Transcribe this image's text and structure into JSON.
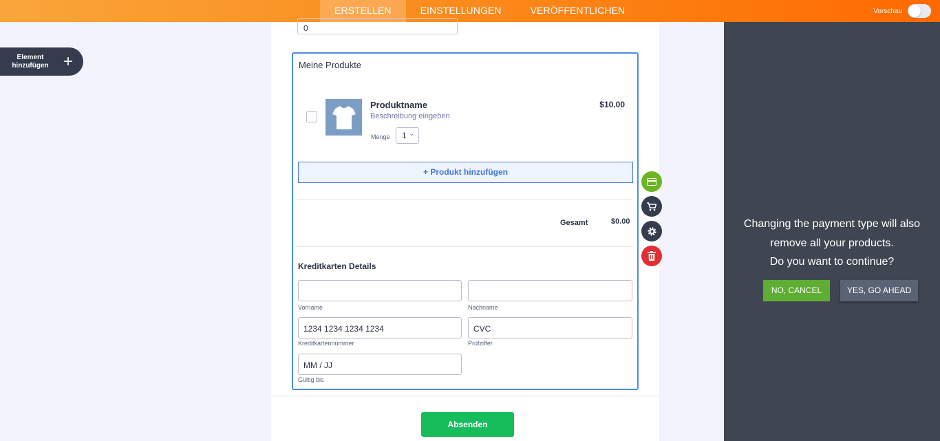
{
  "topbar": {
    "tabs": [
      {
        "label": "ERSTELLEN",
        "active": true
      },
      {
        "label": "EINSTELLUNGEN",
        "active": false
      },
      {
        "label": "VERÖFFENTLICHEN",
        "active": false
      }
    ],
    "preview_label": "Vorschau",
    "preview_enabled": false
  },
  "sidebar": {
    "add_element_label_line1": "Element",
    "add_element_label_line2": "hinzufügen",
    "add_icon": "plus-icon"
  },
  "form": {
    "top_input_value": "0",
    "products": {
      "title": "Meine Produkte",
      "items": [
        {
          "name": "Produktname",
          "description": "Beschreibung eingeben",
          "price": "$10.00",
          "quantity_label": "Menge",
          "quantity_value": "1",
          "image_icon": "tshirt-icon"
        }
      ],
      "add_product_label": "+ Produkt hinzufügen",
      "total_label": "Gesamt",
      "total_value": "$0.00"
    },
    "credit_card": {
      "title": "Kreditkarten Details",
      "first_name_label": "Vorname",
      "last_name_label": "Nachname",
      "card_number_placeholder": "1234 1234 1234 1234",
      "card_number_label": "Kreditkartennummer",
      "cvc_placeholder": "CVC",
      "cvc_label": "Prüfziffer",
      "expiry_placeholder": "MM / JJ",
      "expiry_label": "Gültig bis"
    },
    "submit_label": "Absenden"
  },
  "tools": [
    {
      "name": "payment-icon",
      "color": "#6bb422"
    },
    {
      "name": "cart-icon",
      "color": "#343c4e"
    },
    {
      "name": "gear-icon",
      "color": "#343c4e"
    },
    {
      "name": "trash-icon",
      "color": "#e03030"
    }
  ],
  "dialog": {
    "line1": "Changing the payment type will also",
    "line2": "remove all your products.",
    "line3": "Do you want to continue?",
    "cancel_label": "NO, CANCEL",
    "confirm_label": "YES, GO AHEAD"
  },
  "colors": {
    "accent_orange": "#ff6a00",
    "submit_green": "#18bd5b",
    "panel_dark": "#3f4652"
  }
}
